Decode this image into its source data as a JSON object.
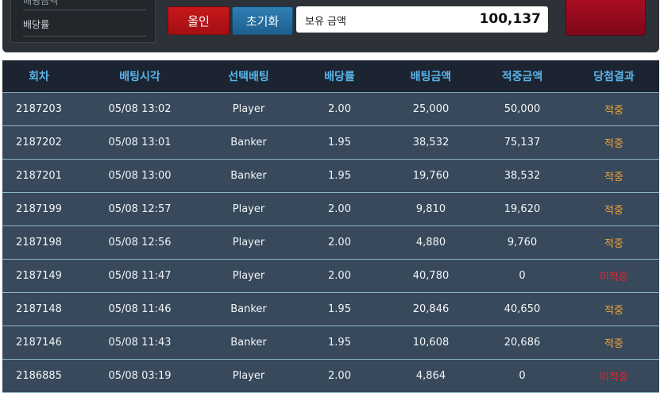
{
  "sidebar": {
    "partial_label": "배팅금액",
    "odds_label": "배당률"
  },
  "controls": {
    "allin_label": "올인",
    "reset_label": "초기화",
    "balance_label": "보유 금액",
    "balance_value": "100,137"
  },
  "table": {
    "headers": [
      "회차",
      "배팅시각",
      "선택배팅",
      "배당률",
      "배팅금액",
      "적중금액",
      "당첨결과"
    ],
    "rows": [
      {
        "round": "2187203",
        "time": "05/08 13:02",
        "pick": "Player",
        "odds": "2.00",
        "bet": "25,000",
        "payout": "50,000",
        "result": "적중",
        "status": "win"
      },
      {
        "round": "2187202",
        "time": "05/08 13:01",
        "pick": "Banker",
        "odds": "1.95",
        "bet": "38,532",
        "payout": "75,137",
        "result": "적중",
        "status": "win"
      },
      {
        "round": "2187201",
        "time": "05/08 13:00",
        "pick": "Banker",
        "odds": "1.95",
        "bet": "19,760",
        "payout": "38,532",
        "result": "적중",
        "status": "win"
      },
      {
        "round": "2187199",
        "time": "05/08 12:57",
        "pick": "Player",
        "odds": "2.00",
        "bet": "9,810",
        "payout": "19,620",
        "result": "적중",
        "status": "win"
      },
      {
        "round": "2187198",
        "time": "05/08 12:56",
        "pick": "Player",
        "odds": "2.00",
        "bet": "4,880",
        "payout": "9,760",
        "result": "적중",
        "status": "win"
      },
      {
        "round": "2187149",
        "time": "05/08 11:47",
        "pick": "Player",
        "odds": "2.00",
        "bet": "40,780",
        "payout": "0",
        "result": "미적중",
        "status": "lose"
      },
      {
        "round": "2187148",
        "time": "05/08 11:46",
        "pick": "Banker",
        "odds": "1.95",
        "bet": "20,846",
        "payout": "40,650",
        "result": "적중",
        "status": "win"
      },
      {
        "round": "2187146",
        "time": "05/08 11:43",
        "pick": "Banker",
        "odds": "1.95",
        "bet": "10,608",
        "payout": "20,686",
        "result": "적중",
        "status": "win"
      },
      {
        "round": "2186885",
        "time": "05/08 03:19",
        "pick": "Player",
        "odds": "2.00",
        "bet": "4,864",
        "payout": "0",
        "result": "미적중",
        "status": "lose"
      }
    ]
  },
  "colors": {
    "win": "#f2a43a",
    "lose": "#e2242a",
    "header_text": "#5ab4ea",
    "row_bg": "#37495b"
  }
}
